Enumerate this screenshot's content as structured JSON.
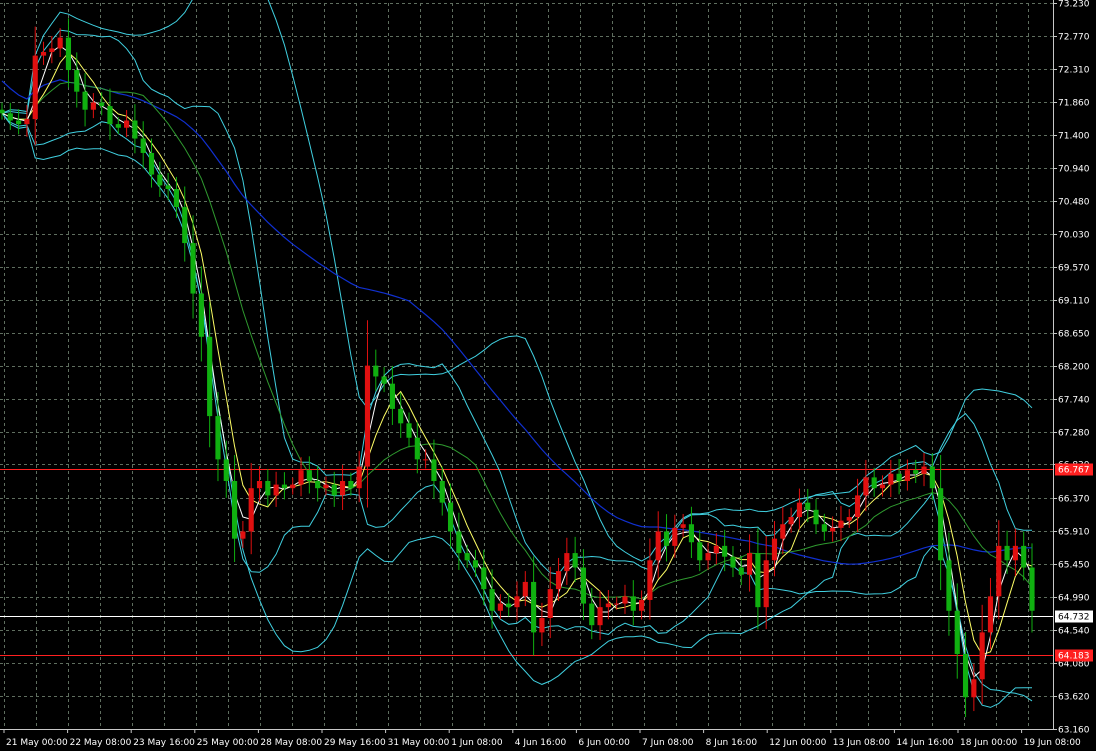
{
  "chart_data": {
    "type": "candlestick",
    "grid": true,
    "colors": {
      "background": "#000000",
      "grid": "#5f6e5f",
      "axis": "#c8c8c8",
      "up": "#e01010",
      "down": "#10b010",
      "bollinger": "#40d0e0",
      "ma_fast": "#ffffff",
      "ma_mid": "#ffff66",
      "ma_slow": "#2f9a2f",
      "ma_long": "#1030d0",
      "hline_red": "#ff2020",
      "hline_white": "#ffffff"
    },
    "y_ticks": [
      "73.230",
      "72.770",
      "72.310",
      "71.860",
      "71.400",
      "70.940",
      "70.480",
      "70.030",
      "69.570",
      "69.110",
      "68.650",
      "68.200",
      "67.740",
      "67.280",
      "66.830",
      "66.370",
      "65.910",
      "65.450",
      "64.990",
      "64.540",
      "64.080",
      "63.620",
      "63.160"
    ],
    "ylim": [
      63.16,
      73.23
    ],
    "x_labels": [
      "21 May 00:00",
      "22 May 08:00",
      "23 May 16:00",
      "25 May 00:00",
      "28 May 08:00",
      "29 May 16:00",
      "31 May 00:00",
      "1 Jun 08:00",
      "4 Jun 16:00",
      "6 Jun 00:00",
      "7 Jun 08:00",
      "8 Jun 16:00",
      "12 Jun 00:00",
      "13 Jun 08:00",
      "14 Jun 16:00",
      "18 Jun 00:00",
      "19 Jun 08:00"
    ],
    "hlines": [
      {
        "value": 66.767,
        "label": "66.767",
        "color": "red"
      },
      {
        "value": 64.732,
        "label": "64.732",
        "color": "white"
      },
      {
        "value": 64.183,
        "label": "64.183",
        "color": "red"
      }
    ],
    "close": [
      71.7,
      71.6,
      71.55,
      71.62,
      72.5,
      72.55,
      72.6,
      72.75,
      72.3,
      72.0,
      71.75,
      71.85,
      71.8,
      71.55,
      71.5,
      71.6,
      71.35,
      71.15,
      70.85,
      70.7,
      70.65,
      70.4,
      69.9,
      69.2,
      68.6,
      67.5,
      66.9,
      66.6,
      65.8,
      65.9,
      66.5,
      66.6,
      66.4,
      66.55,
      66.5,
      66.55,
      66.75,
      66.6,
      66.5,
      66.55,
      66.4,
      66.6,
      66.5,
      66.8,
      68.2,
      68.05,
      67.95,
      67.6,
      67.4,
      67.2,
      66.9,
      66.9,
      66.6,
      66.3,
      65.9,
      65.6,
      65.5,
      65.4,
      65.1,
      64.8,
      64.9,
      64.85,
      65.0,
      65.2,
      64.5,
      64.7,
      65.1,
      65.35,
      65.6,
      65.4,
      64.9,
      64.6,
      64.85,
      64.9,
      64.9,
      65.0,
      64.8,
      64.95,
      65.5,
      65.9,
      65.7,
      65.95,
      66.0,
      65.75,
      65.5,
      65.6,
      65.7,
      65.55,
      65.4,
      65.3,
      65.6,
      64.85,
      65.5,
      65.8,
      66.0,
      66.1,
      66.3,
      66.2,
      66.0,
      65.9,
      65.95,
      66.05,
      66.1,
      66.4,
      66.65,
      66.5,
      66.55,
      66.7,
      66.6,
      66.75,
      66.7,
      66.8,
      66.5,
      65.5,
      64.8,
      64.2,
      63.6,
      63.85,
      64.5,
      65.0,
      65.7,
      65.5,
      65.7,
      65.4,
      64.8
    ]
  }
}
